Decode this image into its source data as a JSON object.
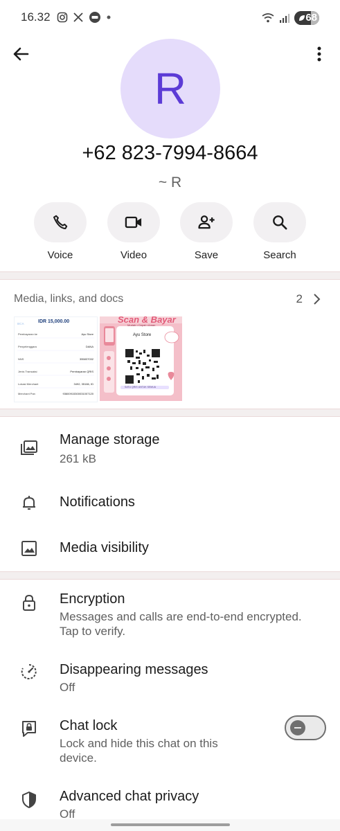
{
  "status_bar": {
    "time": "16.32",
    "notification_icons": [
      "instagram-icon",
      "x-icon",
      "line-icon",
      "dot-icon"
    ],
    "battery_level": "68",
    "battery_fraction": 0.68
  },
  "header": {
    "avatar_letter": "R",
    "phone": "+62 823-7994-8664",
    "alias": "~ R"
  },
  "actions": [
    {
      "label": "Voice",
      "icon": "phone-icon"
    },
    {
      "label": "Video",
      "icon": "video-icon"
    },
    {
      "label": "Save",
      "icon": "add-contact-icon"
    },
    {
      "label": "Search",
      "icon": "search-icon"
    }
  ],
  "media": {
    "title": "Media, links, and docs",
    "count": "2",
    "receipt": {
      "amount": "IDR 15,000.00",
      "rows": [
        [
          "Pembayaran ke",
          "Ayu Store"
        ],
        [
          "Penyelenggara",
          "DANA"
        ],
        [
          "NNS",
          "355837032"
        ],
        [
          "Jenis Transaksi",
          "Pembayaran QRIS"
        ],
        [
          "Lokasi Merchant",
          "3492, 35166, ID"
        ],
        [
          "Merchant Pan",
          "93600915300031007120"
        ]
      ]
    },
    "qris": {
      "heading": "Scan & Bayar",
      "ribbon": "Mudah • Cepat • Aman",
      "store": "Ayu Store",
      "footer": "SATU QRIS UNTUK SEMUA"
    }
  },
  "rows": {
    "manage_storage": {
      "title": "Manage storage",
      "sub": "261 kB"
    },
    "notifications": {
      "title": "Notifications"
    },
    "media_visibility": {
      "title": "Media visibility"
    },
    "encryption": {
      "title": "Encryption",
      "sub1": "Messages and calls are end-to-end encrypted.",
      "sub2": "Tap to verify."
    },
    "disappearing": {
      "title": "Disappearing messages",
      "sub": "Off"
    },
    "chat_lock": {
      "title": "Chat lock",
      "sub1": "Lock and hide this chat on this",
      "sub2": "device.",
      "enabled": false
    },
    "advanced_privacy": {
      "title": "Advanced chat privacy",
      "sub": "Off"
    }
  },
  "colors": {
    "avatar_bg": "#e5dcfb",
    "avatar_text": "#5c3bd6",
    "qris_pink": "#f4bfc9"
  }
}
